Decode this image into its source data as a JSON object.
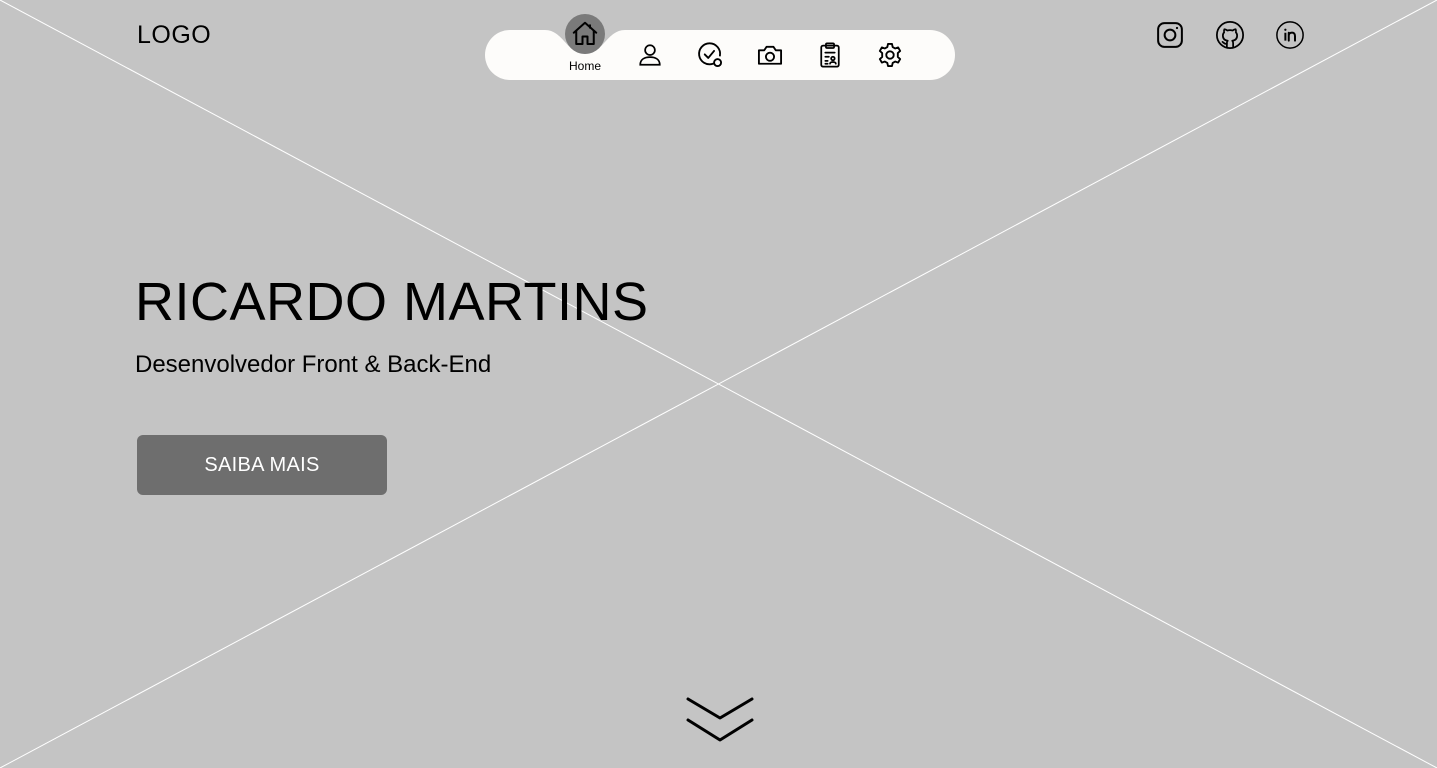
{
  "header": {
    "logo": "LOGO"
  },
  "nav": {
    "items": [
      {
        "icon": "home-icon",
        "label": "Home",
        "active": true
      },
      {
        "icon": "user-icon",
        "label": "",
        "active": false
      },
      {
        "icon": "check-badge-icon",
        "label": "",
        "active": false
      },
      {
        "icon": "camera-icon",
        "label": "",
        "active": false
      },
      {
        "icon": "clipboard-icon",
        "label": "",
        "active": false
      },
      {
        "icon": "gear-icon",
        "label": "",
        "active": false
      }
    ]
  },
  "social": [
    {
      "icon": "instagram-icon"
    },
    {
      "icon": "github-icon"
    },
    {
      "icon": "linkedin-icon"
    }
  ],
  "hero": {
    "title": "RICARDO MARTINS",
    "subtitle": "Desenvolvedor Front & Back-End",
    "cta_label": "SAIBA MAIS"
  },
  "scroll": {
    "icon": "chevron-double-down-icon"
  },
  "colors": {
    "background": "#c4c4c4",
    "nav_bar": "#fdfcfa",
    "active_bubble": "#7a7a7a",
    "button": "#6e6e6e",
    "button_text": "#ffffff"
  }
}
